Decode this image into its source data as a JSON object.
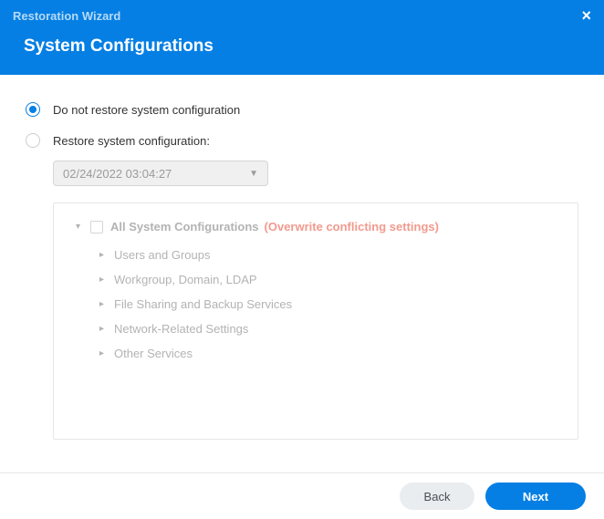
{
  "window": {
    "title": "Restoration Wizard",
    "close_icon": "×"
  },
  "page": {
    "title": "System Configurations"
  },
  "options": {
    "do_not_restore": "Do not restore system configuration",
    "restore": "Restore system configuration:",
    "selected": "do_not_restore"
  },
  "dropdown": {
    "value": "02/24/2022 03:04:27"
  },
  "tree": {
    "root_label": "All System Configurations",
    "root_warning": "(Overwrite conflicting settings)",
    "items": [
      "Users and Groups",
      "Workgroup, Domain, LDAP",
      "File Sharing and Backup Services",
      "Network-Related Settings",
      "Other Services"
    ]
  },
  "footer": {
    "back": "Back",
    "next": "Next"
  }
}
